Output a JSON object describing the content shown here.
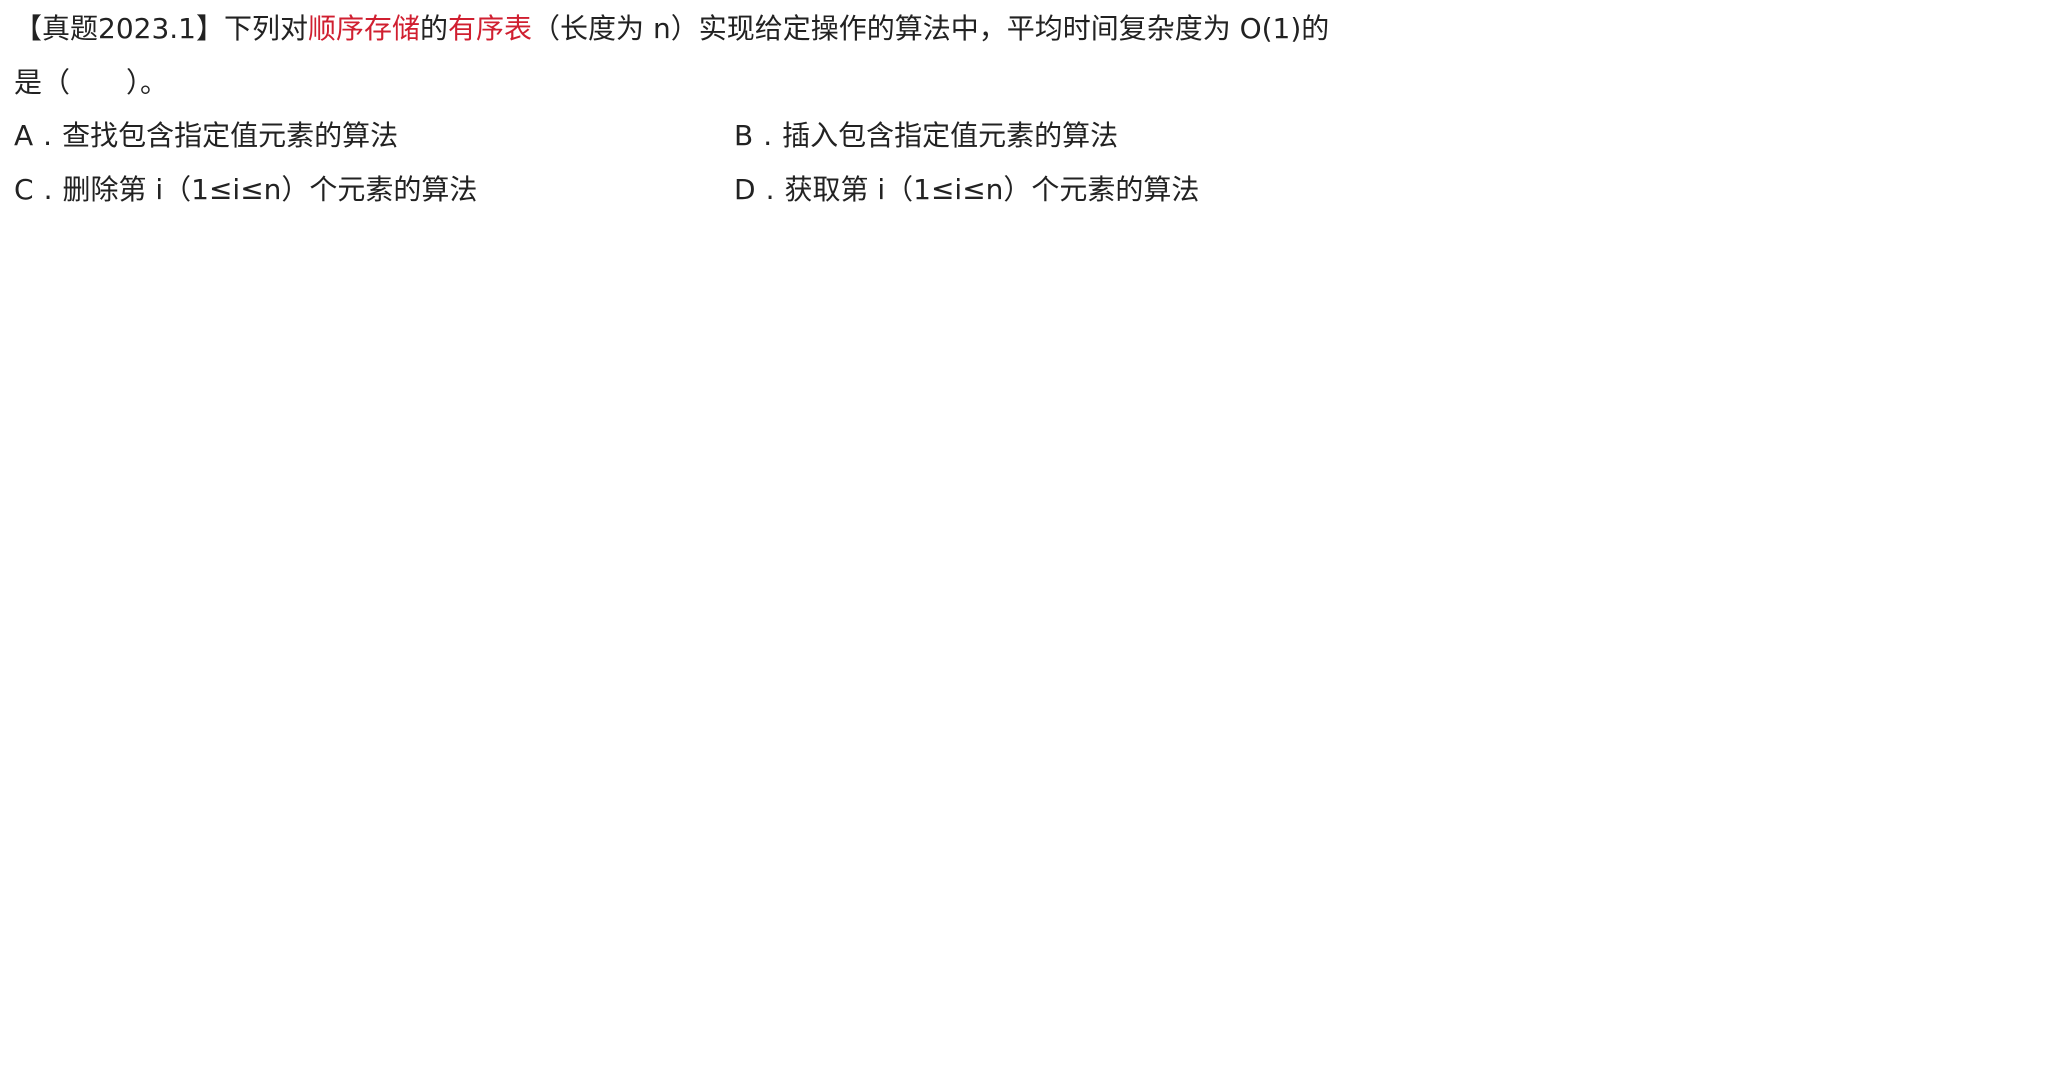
{
  "question": {
    "tag": "【真题2023.1】",
    "seg1": "下列对",
    "highlight1": "顺序存储",
    "seg2": "的",
    "highlight2": "有序表",
    "seg3": "（长度为 n）实现给定操作的算法中，平均时间复杂度为 O(1)的",
    "line2": "是（　　）。"
  },
  "options": [
    {
      "letter": "A",
      "sep": ".",
      "text": "查找包含指定值元素的算法"
    },
    {
      "letter": "B",
      "sep": ".",
      "text": "插入包含指定值元素的算法"
    },
    {
      "letter": "C",
      "sep": ".",
      "text": "删除第 i（1≤i≤n）个元素的算法"
    },
    {
      "letter": "D",
      "sep": ".",
      "text": "获取第 i（1≤i≤n）个元素的算法"
    }
  ],
  "colors": {
    "text": "#222222",
    "highlight": "#d01f30",
    "background": "#ffffff"
  }
}
